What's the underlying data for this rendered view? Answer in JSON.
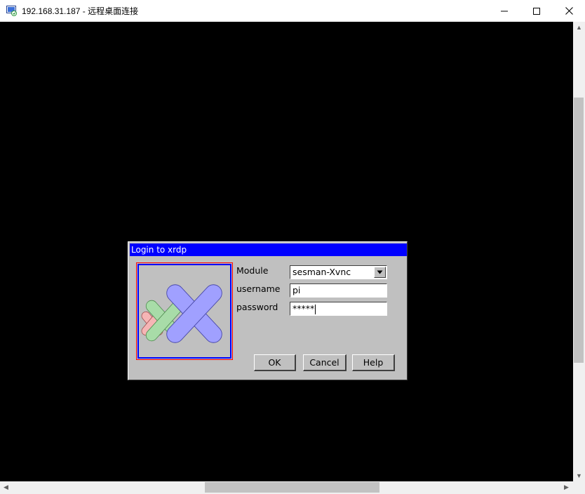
{
  "window": {
    "title": "192.168.31.187 - 远程桌面连接",
    "icon": "remote-desktop-icon"
  },
  "dialog": {
    "title": "Login to xrdp",
    "logo": "xrdp-logo",
    "fields": {
      "module_label": "Module",
      "module_value": "sesman-Xvnc",
      "username_label": "username",
      "username_value": "pi",
      "password_label": "password",
      "password_value": "*****"
    },
    "buttons": {
      "ok": "OK",
      "cancel": "Cancel",
      "help": "Help"
    }
  },
  "colors": {
    "desktop_bg": "#000000",
    "dialog_bg": "#c0c0c0",
    "dialog_title_bg": "#0000ff",
    "dialog_title_fg": "#ffffff"
  }
}
